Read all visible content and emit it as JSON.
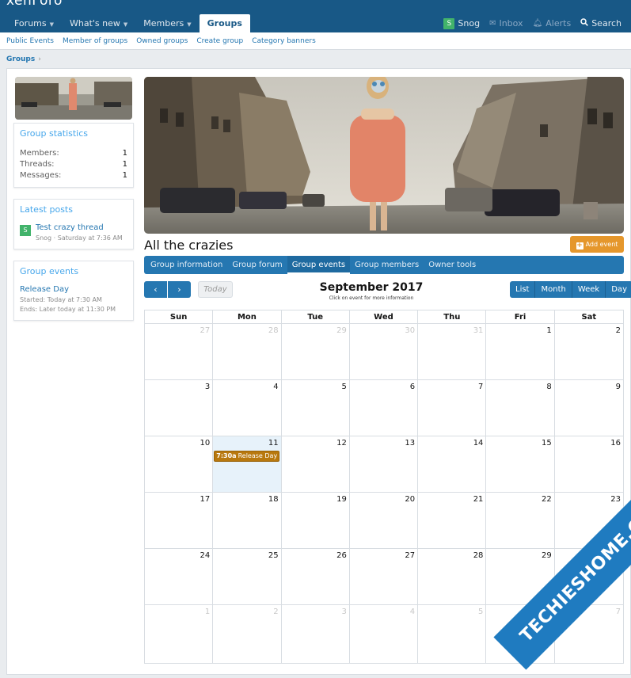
{
  "brand": "xenForo",
  "nav": {
    "tabs": [
      {
        "label": "Forums",
        "caret": true
      },
      {
        "label": "What's new",
        "caret": true
      },
      {
        "label": "Members",
        "caret": true
      }
    ],
    "active_tab": "Groups",
    "user": {
      "initial": "S",
      "name": "Snog"
    },
    "inbox": "Inbox",
    "alerts": "Alerts",
    "search": "Search"
  },
  "subnav": [
    "Public Events",
    "Member of groups",
    "Owned groups",
    "Create group",
    "Category banners"
  ],
  "breadcrumb": {
    "label": "Groups",
    "sep": "›"
  },
  "sidebar": {
    "stats": {
      "title": "Group statistics",
      "rows": [
        {
          "label": "Members:",
          "value": "1"
        },
        {
          "label": "Threads:",
          "value": "1"
        },
        {
          "label": "Messages:",
          "value": "1"
        }
      ]
    },
    "latest": {
      "title": "Latest posts",
      "avatar": "S",
      "post_title": "Test crazy thread",
      "post_meta": "Snog · Saturday at 7:36 AM"
    },
    "events": {
      "title": "Group events",
      "event_title": "Release Day",
      "started": "Started: Today at 7:30 AM",
      "ends": "Ends: Later today at 11:30 PM"
    }
  },
  "group": {
    "title": "All the crazies",
    "add_event": "Add event",
    "tabs": [
      "Group information",
      "Group forum",
      "Group events",
      "Group members",
      "Owner tools"
    ],
    "active_tab_index": 2
  },
  "calendar": {
    "prev": "‹",
    "next": "›",
    "today": "Today",
    "title": "September 2017",
    "subtitle": "Click on event for more information",
    "views": [
      "List",
      "Month",
      "Week",
      "Day"
    ],
    "weekdays": [
      "Sun",
      "Mon",
      "Tue",
      "Wed",
      "Thu",
      "Fri",
      "Sat"
    ],
    "weeks": [
      [
        {
          "d": "27",
          "o": true
        },
        {
          "d": "28",
          "o": true
        },
        {
          "d": "29",
          "o": true
        },
        {
          "d": "30",
          "o": true
        },
        {
          "d": "31",
          "o": true
        },
        {
          "d": "1"
        },
        {
          "d": "2"
        }
      ],
      [
        {
          "d": "3"
        },
        {
          "d": "4"
        },
        {
          "d": "5"
        },
        {
          "d": "6"
        },
        {
          "d": "7"
        },
        {
          "d": "8"
        },
        {
          "d": "9"
        }
      ],
      [
        {
          "d": "10"
        },
        {
          "d": "11",
          "today": true,
          "event_time": "7:30a",
          "event_title": "Release Day"
        },
        {
          "d": "12"
        },
        {
          "d": "13"
        },
        {
          "d": "14"
        },
        {
          "d": "15"
        },
        {
          "d": "16"
        }
      ],
      [
        {
          "d": "17"
        },
        {
          "d": "18"
        },
        {
          "d": "19"
        },
        {
          "d": "20"
        },
        {
          "d": "21"
        },
        {
          "d": "22"
        },
        {
          "d": "23"
        }
      ],
      [
        {
          "d": "24"
        },
        {
          "d": "25"
        },
        {
          "d": "26"
        },
        {
          "d": "27"
        },
        {
          "d": "28"
        },
        {
          "d": "29"
        },
        {
          "d": "30"
        }
      ],
      [
        {
          "d": "1",
          "o": true
        },
        {
          "d": "2",
          "o": true
        },
        {
          "d": "3",
          "o": true
        },
        {
          "d": "4",
          "o": true
        },
        {
          "d": "5",
          "o": true
        },
        {
          "d": "6",
          "o": true
        },
        {
          "d": "7",
          "o": true
        }
      ]
    ]
  },
  "watermark": "TECHIESHOME.COM",
  "colors": {
    "nav_bg": "#185886",
    "accent": "#2577b1",
    "event": "#b8780e",
    "add_event": "#e5972c",
    "today_bg": "#e7f2fa"
  }
}
